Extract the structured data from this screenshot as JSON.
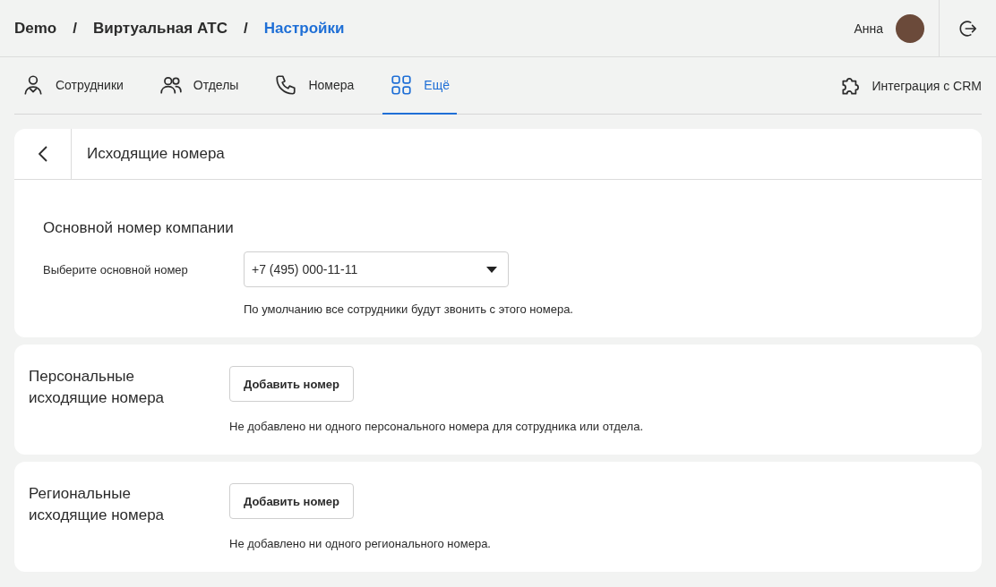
{
  "header": {
    "breadcrumbs": [
      {
        "label": "Demo",
        "selected": false
      },
      {
        "label": "Виртуальная АТС",
        "selected": false
      },
      {
        "label": "Настройки",
        "selected": true
      }
    ],
    "separators": [
      "/",
      "/"
    ],
    "user": {
      "name": "Анна"
    }
  },
  "tabs": [
    {
      "label": "Сотрудники",
      "kind": "person",
      "selected": false
    },
    {
      "label": "Отделы",
      "kind": "group",
      "selected": false
    },
    {
      "label": "Номера",
      "kind": "phone",
      "selected": false
    },
    {
      "label": "Ещё",
      "kind": "grid",
      "selected": true
    }
  ],
  "integration": {
    "label": "Интеграция с CRM"
  },
  "page": {
    "title": "Исходящие номера"
  },
  "sections": [
    {
      "kind": "select",
      "title": "Основной номер компании",
      "label": "Выберите основной номер",
      "value": "+7 (495) 000-11-11",
      "hint": "По умолчанию все сотрудники будут звонить с этого номера."
    },
    {
      "kind": "add",
      "title": "Персональные исходящие номера",
      "button": "Добавить номер",
      "hint": "Не добавлено ни одного персонального номера для сотрудника или отдела."
    },
    {
      "kind": "add",
      "title": "Региональные исходящие номера",
      "button": "Добавить номер",
      "hint": "Не добавлено ни одного регионального номера."
    }
  ]
}
